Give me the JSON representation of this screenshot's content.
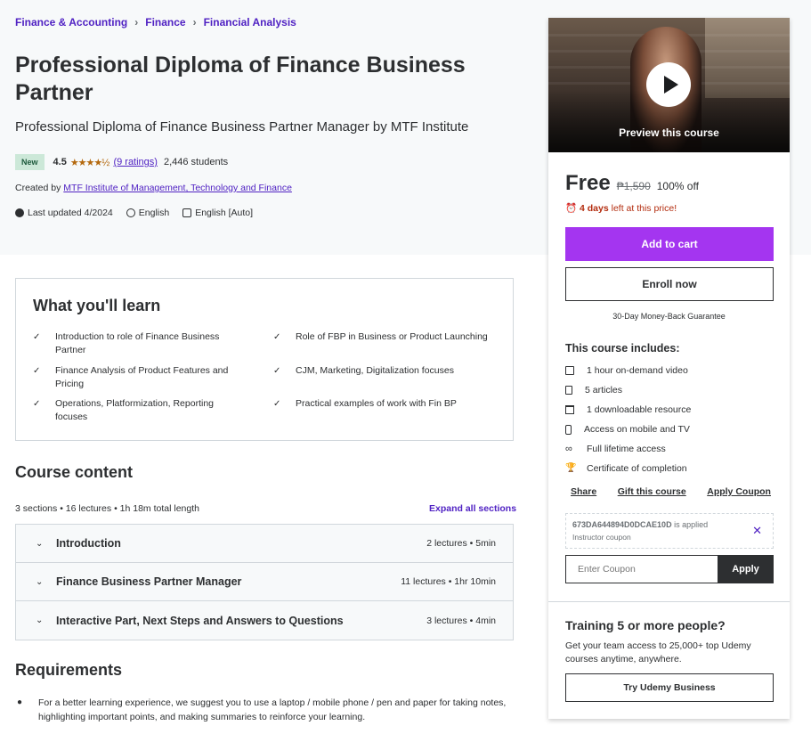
{
  "breadcrumb": [
    "Finance & Accounting",
    "Finance",
    "Financial Analysis"
  ],
  "course": {
    "title": "Professional Diploma of Finance Business Partner",
    "subtitle": "Professional Diploma of Finance Business Partner Manager by MTF Institute",
    "badge": "New",
    "rating": "4.5",
    "stars": "★★★★½",
    "ratings_count": "(9 ratings)",
    "students": "2,446 students",
    "created_by_label": "Created by",
    "author": "MTF Institute of Management, Technology and Finance",
    "last_updated": "Last updated 4/2024",
    "language": "English",
    "captions": "English [Auto]"
  },
  "learn": {
    "title": "What you'll learn",
    "items": [
      "Introduction to role of Finance Business Partner",
      "Role of FBP in Business or Product Launching",
      "Finance Analysis of Product Features and Pricing",
      "CJM, Marketing, Digitalization focuses",
      "Operations, Platformization, Reporting focuses",
      "Practical examples of work with Fin BP"
    ]
  },
  "content": {
    "title": "Course content",
    "summary": "3 sections • 16 lectures • 1h 18m total length",
    "expand_label": "Expand all sections",
    "sections": [
      {
        "title": "Introduction",
        "meta": "2 lectures • 5min"
      },
      {
        "title": "Finance Business Partner Manager",
        "meta": "11 lectures • 1hr 10min"
      },
      {
        "title": "Interactive Part, Next Steps and Answers to Questions",
        "meta": "3 lectures • 4min"
      }
    ]
  },
  "requirements": {
    "title": "Requirements",
    "items": [
      "For a better learning experience, we suggest you to use a laptop / mobile phone / pen and paper for taking notes, highlighting important points, and making summaries to reinforce your learning."
    ]
  },
  "sidebar": {
    "preview_label": "Preview this course",
    "price": "Free",
    "original_price": "₱1,590",
    "discount": "100% off",
    "timer_bold": "4 days",
    "timer_rest": " left at this price!",
    "add_to_cart": "Add to cart",
    "enroll_now": "Enroll now",
    "guarantee": "30-Day Money-Back Guarantee",
    "includes_title": "This course includes:",
    "includes": [
      "1 hour on-demand video",
      "5 articles",
      "1 downloadable resource",
      "Access on mobile and TV",
      "Full lifetime access",
      "Certificate of completion"
    ],
    "links": {
      "share": "Share",
      "gift": "Gift this course",
      "apply_coupon": "Apply Coupon"
    },
    "coupon": {
      "code": "673DA644894D0DCAE10D",
      "applied_text": " is applied",
      "type": "Instructor coupon",
      "input_placeholder": "Enter Coupon",
      "apply_label": "Apply"
    },
    "training": {
      "title": "Training 5 or more people?",
      "text": "Get your team access to 25,000+ top Udemy courses anytime, anywhere.",
      "button": "Try Udemy Business"
    }
  },
  "colors": {
    "accent_purple": "#a435f0",
    "link_purple": "#5022c3",
    "star": "#b4690e",
    "timer_red": "#b32d0f",
    "badge_green": "#cce8d8"
  }
}
